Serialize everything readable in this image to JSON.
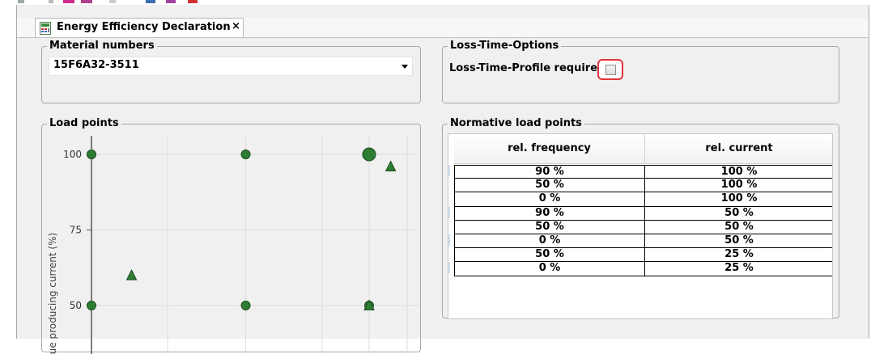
{
  "tab": {
    "title": "Energy Efficiency Declaration",
    "close_label": "×",
    "icon": "document-table-icon"
  },
  "colors": {
    "accent_green": "#2e7d32",
    "highlight_red": "#e5333a"
  },
  "material_numbers": {
    "legend": "Material numbers",
    "selected": "15F6A32-3511"
  },
  "loss_time": {
    "legend": "Loss-Time-Options",
    "checkbox_label": "Loss-Time-Profile required",
    "checked": false
  },
  "load_points": {
    "legend": "Load points",
    "chart_data": {
      "type": "scatter",
      "ylabel": "orque producing current (%)",
      "yticks": [
        "100",
        "75",
        "50"
      ],
      "ylim": [
        50,
        100
      ],
      "grid": true,
      "series": [
        {
          "marker": "circle",
          "points": [
            {
              "x": 0,
              "y": 100
            },
            {
              "x": 50,
              "y": 100
            },
            {
              "x": 90,
              "y": 100,
              "size": "large"
            },
            {
              "x": 0,
              "y": 50
            },
            {
              "x": 50,
              "y": 50
            },
            {
              "x": 90,
              "y": 50
            }
          ]
        },
        {
          "marker": "triangle",
          "points": [
            {
              "x": 13,
              "y": 60
            },
            {
              "x": 97,
              "y": 96
            },
            {
              "x": 90,
              "y": 50
            }
          ]
        }
      ]
    }
  },
  "normative": {
    "legend": "Normative load points",
    "columns": [
      "rel. frequency",
      "rel. current"
    ],
    "rows": [
      [
        "90 %",
        "100 %"
      ],
      [
        "50 %",
        "100 %"
      ],
      [
        "0 %",
        "100 %"
      ],
      [
        "90 %",
        "50 %"
      ],
      [
        "50 %",
        "50 %"
      ],
      [
        "0 %",
        "50 %"
      ],
      [
        "50 %",
        "25 %"
      ],
      [
        "0 %",
        "25 %"
      ]
    ]
  }
}
